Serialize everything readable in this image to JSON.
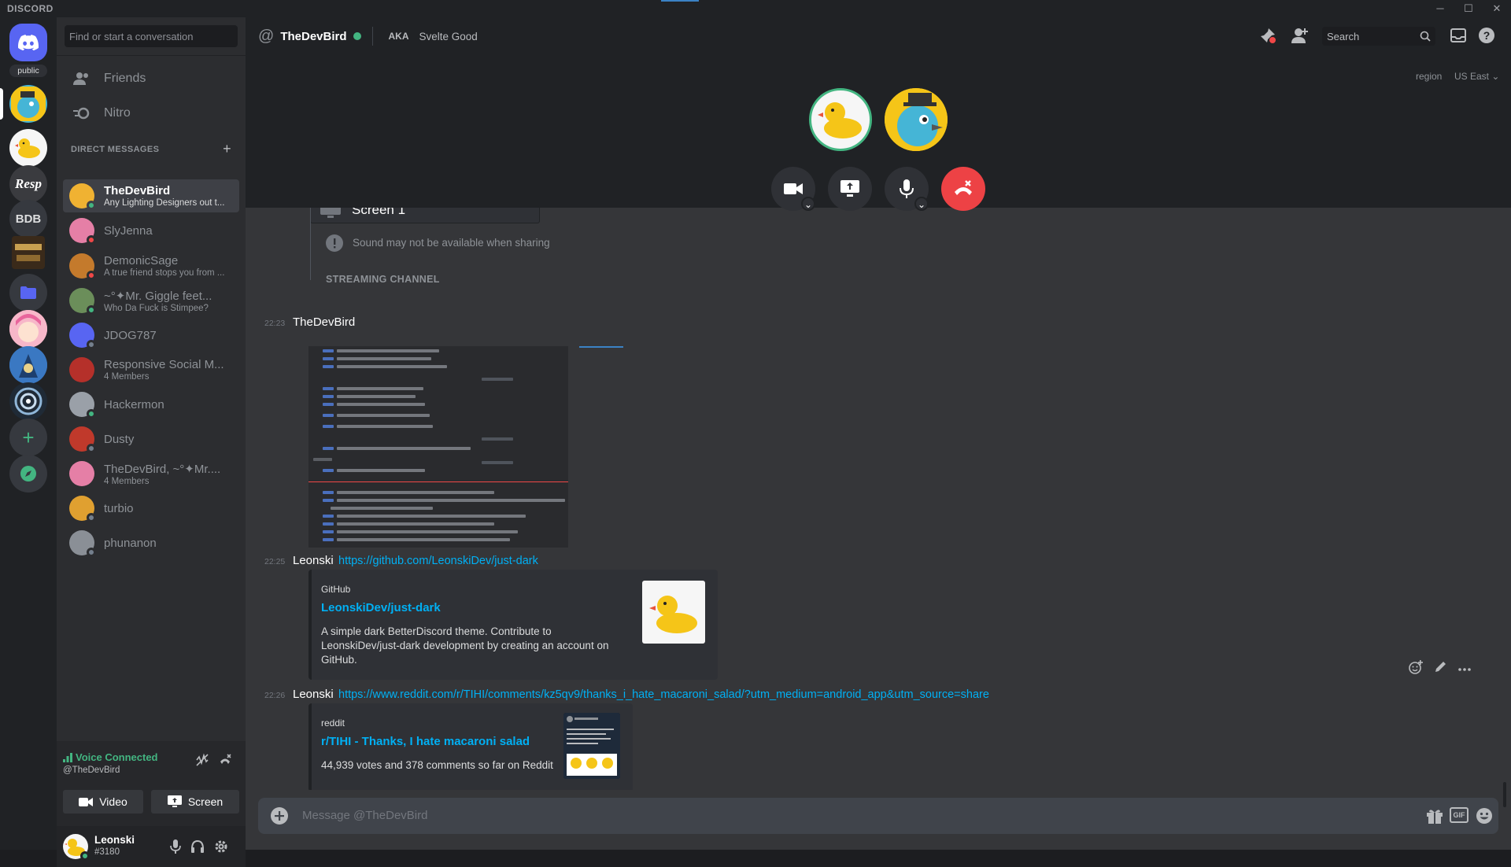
{
  "app": {
    "brand": "DISCORD"
  },
  "window_controls": [
    "─",
    "☐",
    "✕"
  ],
  "rail": {
    "public_label": "public",
    "bdb_label": "BDB",
    "add_label": "+"
  },
  "sidebar": {
    "search_placeholder": "Find or start a conversation",
    "nav": [
      {
        "label": "Friends"
      },
      {
        "label": "Nitro"
      }
    ],
    "dm_header": "DIRECT MESSAGES",
    "dms": [
      {
        "name": "TheDevBird",
        "sub": "Any Lighting Designers out t...",
        "color": "#f0b232",
        "status": "#43b581"
      },
      {
        "name": "SlyJenna",
        "sub": "",
        "color": "#e57fa6",
        "status": "#f04747"
      },
      {
        "name": "DemonicSage",
        "sub": "A true friend stops you from ...",
        "color": "#c47a2c",
        "status": "#f04747"
      },
      {
        "name": "~°✦Mr. Giggle feet...",
        "sub": "Who Da Fuck is Stimpee?",
        "color": "#6b8e5a",
        "status": "#43b581"
      },
      {
        "name": "JDOG787",
        "sub": "",
        "color": "#5865f2",
        "status": "#747f8d"
      },
      {
        "name": "Responsive Social M...",
        "sub": "4 Members",
        "color": "#b5302a",
        "status": ""
      },
      {
        "name": "Hackermon",
        "sub": "",
        "color": "#9aa0a8",
        "status": "#43b581"
      },
      {
        "name": "Dusty",
        "sub": "",
        "color": "#c0392b",
        "status": "#747f8d"
      },
      {
        "name": "TheDevBird, ~°✦Mr....",
        "sub": "4 Members",
        "color": "#e57fa6",
        "status": ""
      },
      {
        "name": "turbio",
        "sub": "",
        "color": "#e0a030",
        "status": "#747f8d"
      },
      {
        "name": "phunanon",
        "sub": "",
        "color": "#8a8f96",
        "status": "#747f8d"
      }
    ],
    "voice": {
      "status": "Voice Connected",
      "channel": "@TheDevBird",
      "video_label": "Video",
      "screen_label": "Screen"
    },
    "user": {
      "name": "Leonski",
      "tag": "#3180"
    }
  },
  "topbar": {
    "title": "TheDevBird",
    "aka_label": "AKA",
    "aka_value": "Svelte Good",
    "search_placeholder": "Search",
    "region_label": "region",
    "region_value": "US East"
  },
  "messages": {
    "screen_label": "Screen 1",
    "sound_notice": "Sound may not be available when sharing",
    "streaming_header": "STREAMING CHANNEL",
    "m1": {
      "time": "22:23",
      "author": "TheDevBird"
    },
    "m2": {
      "time": "22:25",
      "author": "Leonski",
      "link": "https://github.com/LeonskiDev/just-dark",
      "embed": {
        "provider": "GitHub",
        "title": "LeonskiDev/just-dark",
        "desc1": "A simple dark BetterDiscord theme. Contribute to",
        "desc2": "LeonskiDev/just-dark development by creating an account on",
        "desc3": "GitHub."
      }
    },
    "m3": {
      "time": "22:26",
      "author": "Leonski",
      "link": "https://www.reddit.com/r/TIHI/comments/kz5qv9/thanks_i_hate_macaroni_salad/?utm_medium=android_app&utm_source=share",
      "embed": {
        "provider": "reddit",
        "title": "r/TIHI - Thanks, I hate macaroni salad",
        "desc": "44,939 votes and 378 comments so far on Reddit"
      }
    }
  },
  "composer": {
    "placeholder": "Message @TheDevBird",
    "gif_label": "GIF"
  }
}
